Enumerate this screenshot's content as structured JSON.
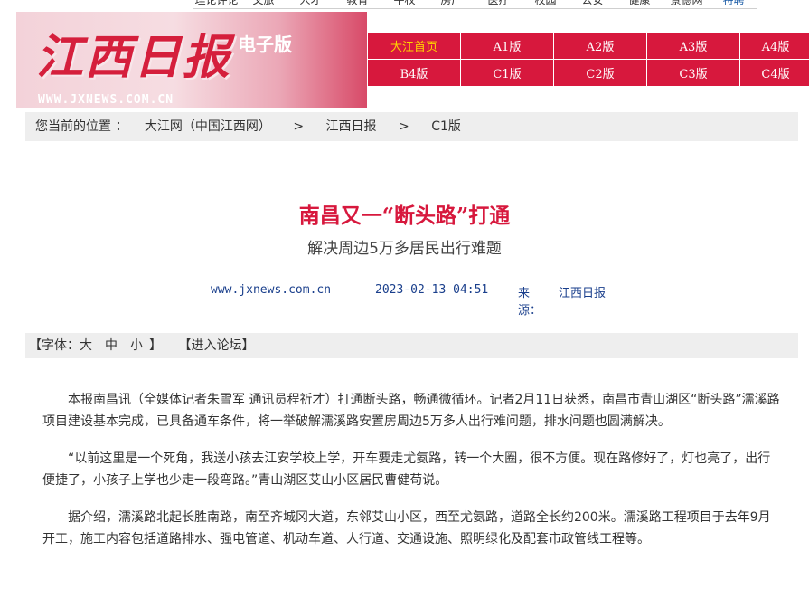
{
  "top_nav": [
    "理论评论",
    "文旅",
    "人才",
    "教育",
    "平权",
    "房产",
    "医疗",
    "校园",
    "公安",
    "健康",
    "景德网",
    "特聘"
  ],
  "banner": {
    "logo_text": "江西日报",
    "edition_label": "电子版",
    "site_url": "WWW.JXNEWS.COM.CN"
  },
  "editions": [
    "大江首页",
    "A1版",
    "A2版",
    "A3版",
    "A4版",
    "B4版",
    "C1版",
    "C2版",
    "C3版",
    "C4版"
  ],
  "breadcrumb": {
    "prefix": "您当前的位置 ：",
    "items": [
      "大江网（中国江西网）",
      "江西日报",
      "C1版"
    ],
    "separator": ">"
  },
  "article": {
    "title": "南昌又一“断头路”打通",
    "subtitle": "解决周边5万多居民出行难题",
    "url": "www.jxnews.com.cn",
    "datetime": "2023-02-13 04:51",
    "source_label": "来源：",
    "source": "江西日报",
    "paragraphs": [
      "本报南昌讯（全媒体记者朱雪军 通讯员程祈才）打通断头路，畅通微循环。记者2月11日获悉，南昌市青山湖区“断头路”濡溪路项目建设基本完成，已具备通车条件，将一举破解濡溪路安置房周边5万多人出行难问题，排水问题也圆满解决。",
      "“以前这里是一个死角，我送小孩去江安学校上学，开车要走尤氨路，转一个大圈，很不方便。现在路修好了，灯也亮了，出行便捷了，小孩子上学也少走一段弯路。”青山湖区艾山小区居民曹健苟说。",
      "据介绍，濡溪路北起长胜南路，南至齐城冈大道，东邻艾山小区，西至尤氨路，道路全长约200米。濡溪路工程项目于去年9月开工，施工内容包括道路排水、强电管道、机动车道、人行道、交通设施、照明绿化及配套市政管线工程等。"
    ]
  },
  "font_bar": {
    "label_open": "【字体：",
    "sizes": [
      "大",
      "中",
      "小"
    ],
    "label_close": "】",
    "forum": "【进入论坛】"
  },
  "colors": {
    "accent": "#d7183d",
    "link": "#1a3f8c",
    "bar_bg": "#eeeeee"
  }
}
